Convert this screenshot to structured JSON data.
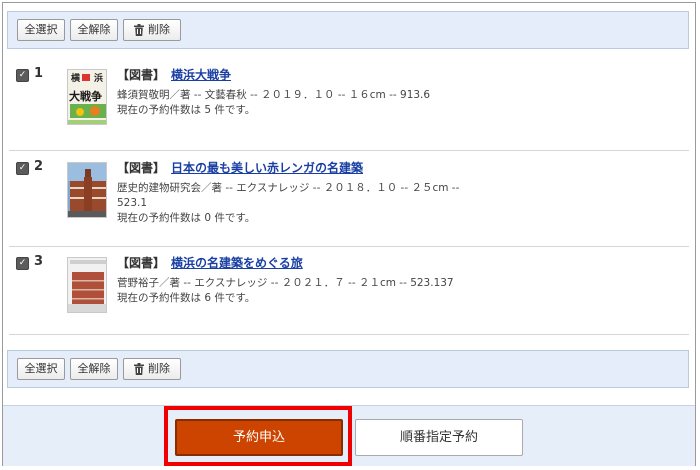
{
  "toolbar": {
    "select_all": "全選択",
    "deselect_all": "全解除",
    "delete": "削除"
  },
  "items": [
    {
      "number": "1",
      "category": "【図書】",
      "title": "横浜大戦争",
      "meta1": "蜂須賀敬明／著 -- 文藝春秋 -- ２０１９．１０ -- １６cm -- 913.6",
      "meta2": "",
      "reservations": "現在の予約件数は 5 件です。",
      "cover_text": "横　浜\n大戦争"
    },
    {
      "number": "2",
      "category": "【図書】",
      "title": "日本の最も美しい赤レンガの名建築",
      "meta1": "歴史的建物研究会／著 -- エクスナレッジ -- ２０１８．１０ -- ２５cm --",
      "meta2": "523.1",
      "reservations": "現在の予約件数は 0 件です。"
    },
    {
      "number": "3",
      "category": "【図書】",
      "title": "横浜の名建築をめぐる旅",
      "meta1": "菅野裕子／著 -- エクスナレッジ -- ２０２１．７ -- ２１cm -- 523.137",
      "meta2": "",
      "reservations": "現在の予約件数は 6 件です。"
    }
  ],
  "footer": {
    "apply_label": "予約申込",
    "order_label": "順番指定予約"
  },
  "colors": {
    "toolbar_bg": "#e4edf9",
    "link": "#1a3fa3",
    "apply_bg": "#cc4400",
    "highlight": "#f00000"
  }
}
